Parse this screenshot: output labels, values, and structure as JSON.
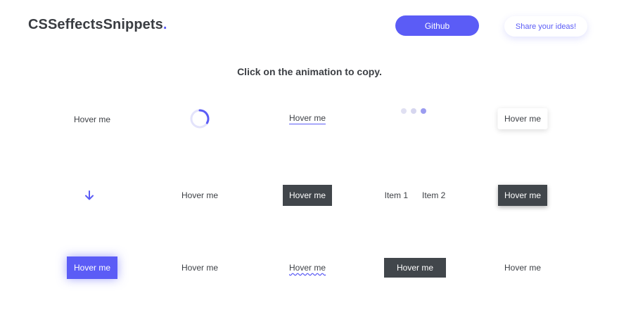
{
  "header": {
    "logo_text": "CSSeffectsSnippets",
    "logo_dot": ".",
    "github_label": "Github",
    "share_label": "Share your ideas!"
  },
  "subtitle": "Click on the animation to copy.",
  "grid": {
    "row1": {
      "hover_plain": "Hover me",
      "spinner_icon": "loading-spinner-icon",
      "hover_underline": "Hover me",
      "dots_icon": "bouncing-dots-icon",
      "hover_shadow_button": "Hover me"
    },
    "row2": {
      "arrow_icon": "arrow-down-icon",
      "hover_plain": "Hover me",
      "hover_dark_button": "Hover me",
      "item1": "Item 1",
      "item2": "Item 2",
      "hover_dark_shadow_button": "Hover me"
    },
    "row3": {
      "hover_glow_button": "Hover me",
      "hover_plain": "Hover me",
      "hover_wavy": "Hover me",
      "hover_dark_wide_button": "Hover me",
      "hover_plain_last": "Hover me"
    }
  },
  "colors": {
    "accent": "#5b5cf6",
    "dark_button": "#41464b",
    "text": "#3c3f44"
  }
}
